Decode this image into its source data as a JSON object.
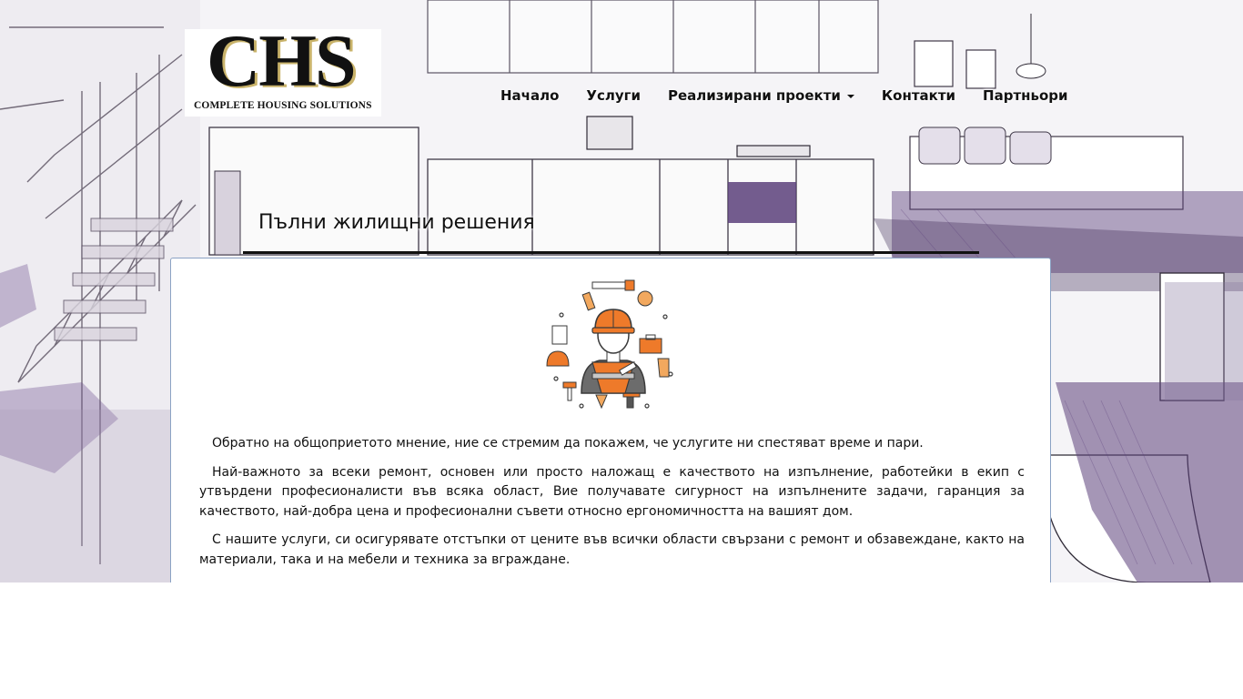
{
  "logo": {
    "main": "CHS",
    "sub": "COMPLETE HOUSING SOLUTIONS"
  },
  "nav": {
    "items": [
      {
        "label": "Начало"
      },
      {
        "label": "Услуги"
      },
      {
        "label": "Реализирани проекти",
        "has_dropdown": true
      },
      {
        "label": "Контакти"
      },
      {
        "label": "Партньори"
      }
    ]
  },
  "page": {
    "title": "Пълни жилищни решения"
  },
  "content": {
    "illustration_icon": "construction-worker-with-tools-icon",
    "paragraphs": [
      "Обратно на общоприетото мнение, ние се стремим да покажем, че услугите ни спестяват време и пари.",
      "Най-важното за всеки ремонт, основен или просто наложащ е качеството на изпълнение, работейки в екип с утвърдени професионалисти във всяка област, Вие получавате сигурност на изпълнените задачи, гаранция за качеството, най-добра цена и професионални съвети относно ергономичността на вашият дом.",
      "С нашите услуги, си осигурявате отстъпки от цените във всички области свързани с ремонт и обзавеждане, както на материали, така и на мебели и техника за вграждане."
    ]
  },
  "colors": {
    "accent_purple": "#6a4c8c",
    "worker_orange": "#ee7a2a",
    "card_border": "#8ba2c4"
  }
}
